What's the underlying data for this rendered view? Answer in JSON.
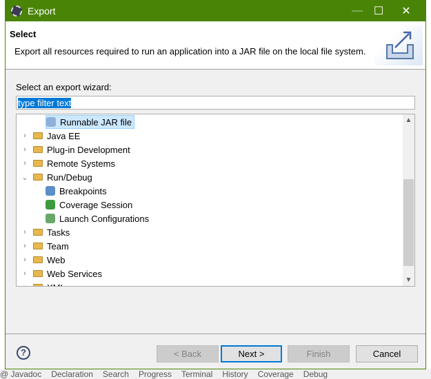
{
  "dialog": {
    "title": "Export",
    "minimize": "—",
    "maximize": "☐",
    "close": "✕"
  },
  "header": {
    "title": "Select",
    "description": "Export all resources required to run an application into a JAR file on the local file system."
  },
  "wizard_label": "Select an export wizard:",
  "filter": {
    "value": "type filter text"
  },
  "tree": [
    {
      "label": "Runnable JAR file",
      "type": "item",
      "level": 1,
      "selected": true,
      "icon": "runnable-jar-icon"
    },
    {
      "label": "Java EE",
      "type": "folder",
      "expanded": false
    },
    {
      "label": "Plug-in Development",
      "type": "folder",
      "expanded": false
    },
    {
      "label": "Remote Systems",
      "type": "folder",
      "expanded": false
    },
    {
      "label": "Run/Debug",
      "type": "folder",
      "expanded": true
    },
    {
      "label": "Breakpoints",
      "type": "item",
      "level": 1,
      "icon": "breakpoints-icon"
    },
    {
      "label": "Coverage Session",
      "type": "item",
      "level": 1,
      "icon": "coverage-icon"
    },
    {
      "label": "Launch Configurations",
      "type": "item",
      "level": 1,
      "icon": "launch-config-icon"
    },
    {
      "label": "Tasks",
      "type": "folder",
      "expanded": false
    },
    {
      "label": "Team",
      "type": "folder",
      "expanded": false
    },
    {
      "label": "Web",
      "type": "folder",
      "expanded": false
    },
    {
      "label": "Web Services",
      "type": "folder",
      "expanded": false
    },
    {
      "label": "XML",
      "type": "folder",
      "expanded": false
    }
  ],
  "buttons": {
    "back": "< Back",
    "next": "Next >",
    "finish": "Finish",
    "cancel": "Cancel"
  },
  "background_tabs": [
    "@ Javadoc",
    "Declaration",
    "Search",
    "Progress",
    "Terminal",
    "History",
    "Coverage",
    "Debug"
  ],
  "colors": {
    "titlebar": "#4a8407",
    "selection": "#0078d7"
  }
}
